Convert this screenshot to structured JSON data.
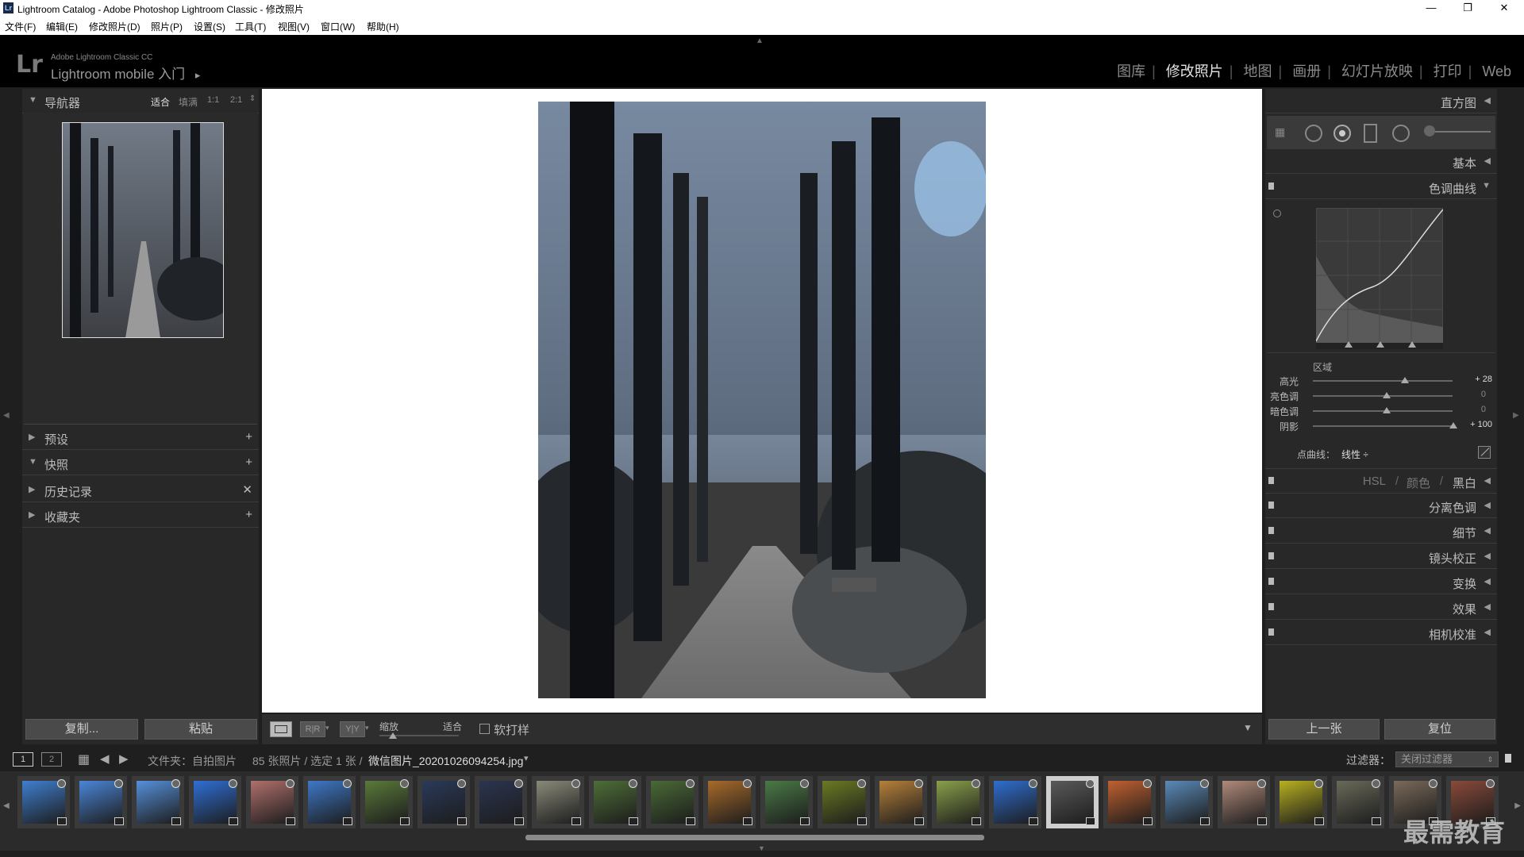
{
  "window": {
    "title": "Lightroom Catalog - Adobe Photoshop Lightroom Classic - 修改照片",
    "app_icon": "Lr",
    "controls": [
      "—",
      "❐",
      "✕"
    ]
  },
  "menu": [
    "文件(F)",
    "编辑(E)",
    "修改照片(D)",
    "照片(P)",
    "设置(S)",
    "工具(T)",
    "视图(V)",
    "窗口(W)",
    "帮助(H)"
  ],
  "identity": {
    "logo": "Lr",
    "product_small": "Adobe Lightroom Classic CC",
    "product_main": "Lightroom mobile 入门",
    "play_icon": "▸"
  },
  "modules": [
    {
      "label": "图库",
      "active": false
    },
    {
      "label": "修改照片",
      "active": true
    },
    {
      "label": "地图",
      "active": false
    },
    {
      "label": "画册",
      "active": false
    },
    {
      "label": "幻灯片放映",
      "active": false
    },
    {
      "label": "打印",
      "active": false
    },
    {
      "label": "Web",
      "active": false
    }
  ],
  "left": {
    "navigator": {
      "title": "导航器",
      "zoom_options": [
        "适合",
        "填满",
        "1:1",
        "2:1"
      ]
    },
    "sections": [
      {
        "label": "预设",
        "end": "+"
      },
      {
        "label": "快照",
        "end": "+"
      },
      {
        "label": "历史记录",
        "end": "✕"
      },
      {
        "label": "收藏夹",
        "end": "+"
      }
    ],
    "copy_btn": "复制...",
    "paste_btn": "粘贴"
  },
  "right": {
    "histogram": "直方图",
    "basic": "基本",
    "tone_curve": "色调曲线",
    "region_label": "区域",
    "sliders": [
      {
        "label": "高光",
        "value": "+ 28",
        "pos": 0.63
      },
      {
        "label": "亮色调",
        "value": "0",
        "pos": 0.5
      },
      {
        "label": "暗色调",
        "value": "0",
        "pos": 0.5
      },
      {
        "label": "阴影",
        "value": "+ 100",
        "pos": 1.0
      }
    ],
    "point_curve_label": "点曲线：",
    "point_curve_value": "线性 ÷",
    "hsl": "HSL",
    "color": "颜色",
    "bw": "黑白",
    "sep": "/",
    "panels": [
      "分离色调",
      "细节",
      "镜头校正",
      "变换",
      "效果",
      "相机校准"
    ],
    "prev_btn": "上一张",
    "reset_btn": "复位"
  },
  "toolbar": {
    "zoom_label": "缩放",
    "fit_label": "适合",
    "softproof": "软打样"
  },
  "filmstrip_bar": {
    "page1": "1",
    "page2": "2",
    "source": "文件夹：自拍图片",
    "count": "85 张照片 / 选定 1 张 /",
    "filename": "微信图片_20201026094254.jpg",
    "dropdown_icon": "▾",
    "filter_label": "过滤器：",
    "filter_value": "关闭过滤器"
  },
  "watermark": "最需教育",
  "thumbs": [
    {
      "color": "#3f7fd0"
    },
    {
      "color": "#4a86d8"
    },
    {
      "color": "#5690db"
    },
    {
      "color": "#2f6fd6"
    },
    {
      "color": "#b0706c"
    },
    {
      "color": "#3e78c8"
    },
    {
      "color": "#5a7a3a"
    },
    {
      "color": "#2a3a5a"
    },
    {
      "color": "#2b3550"
    },
    {
      "color": "#8a8a7a"
    },
    {
      "color": "#4e6e38"
    },
    {
      "color": "#4a6a36"
    },
    {
      "color": "#a86a2a"
    },
    {
      "color": "#4a7a46"
    },
    {
      "color": "#6a7a22"
    },
    {
      "color": "#b6803a"
    },
    {
      "color": "#8aa04a"
    },
    {
      "color": "#2f6ed0"
    },
    {
      "color": "#5a5a5a",
      "selected": true
    },
    {
      "color": "#c06030"
    },
    {
      "color": "#5a8ab8"
    },
    {
      "color": "#b08a7a"
    },
    {
      "color": "#b8b020"
    },
    {
      "color": "#6a6a5a"
    },
    {
      "color": "#7a6a5a"
    },
    {
      "color": "#8a4a3a"
    }
  ]
}
